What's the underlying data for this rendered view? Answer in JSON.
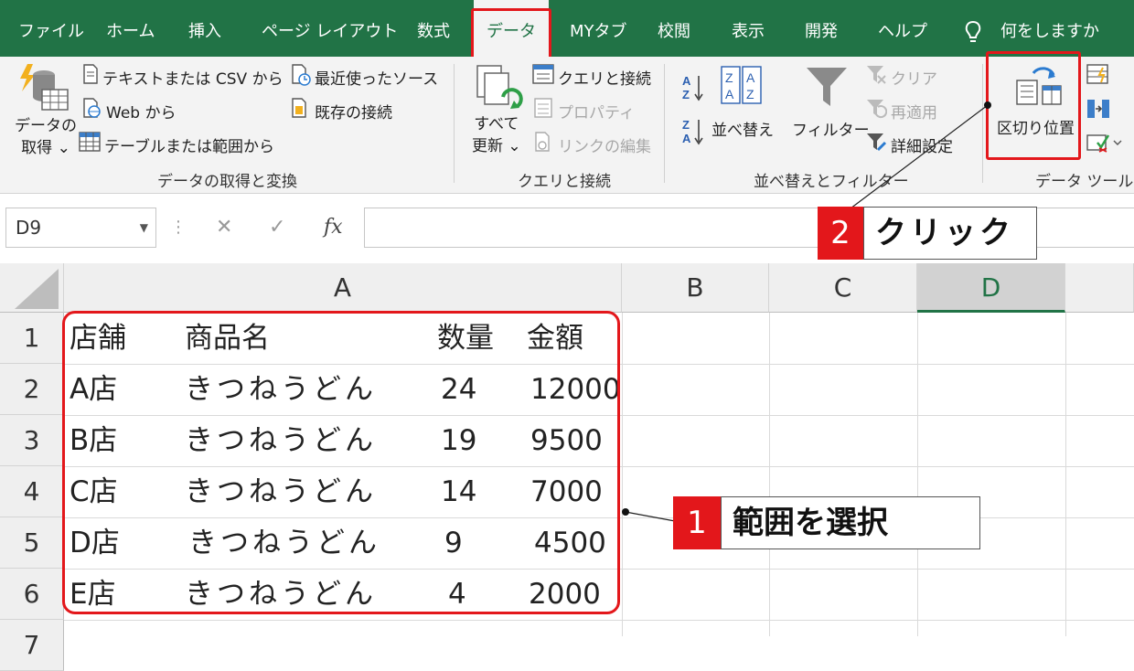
{
  "ribbon_tabs": [
    {
      "label": "ファイル"
    },
    {
      "label": "ホーム"
    },
    {
      "label": "挿入"
    },
    {
      "label": "ページ レイアウト"
    },
    {
      "label": "数式"
    },
    {
      "label": "データ",
      "active": true
    },
    {
      "label": "MYタブ"
    },
    {
      "label": "校閲"
    },
    {
      "label": "表示"
    },
    {
      "label": "開発"
    },
    {
      "label": "ヘルプ"
    }
  ],
  "tell_me": "何をしますか",
  "groups": {
    "get_data": {
      "label": "データの取得と変換",
      "get_data_button": [
        "データの",
        "取得 ⌄"
      ],
      "text_csv": "テキストまたは CSV から",
      "web": "Web から",
      "table_range": "テーブルまたは範囲から",
      "recent_sources": "最近使ったソース",
      "existing_connections": "既存の接続"
    },
    "queries": {
      "label": "クエリと接続",
      "refresh_all": [
        "すべて",
        "更新 ⌄"
      ],
      "queries_connections": "クエリと接続",
      "properties": "プロパティ",
      "edit_links": "リンクの編集"
    },
    "sort_filter": {
      "label": "並べ替えとフィルター",
      "sort": "並べ替え",
      "filter": "フィルター",
      "clear": "クリア",
      "reapply": "再適用",
      "advanced": "詳細設定"
    },
    "data_tools": {
      "label": "データ ツール",
      "text_to_columns": "区切り位置"
    }
  },
  "formula_bar": {
    "name_box": "D9",
    "cancel": "✕",
    "enter": "✓",
    "fx": "fx",
    "value": ""
  },
  "columns": [
    "A",
    "B",
    "C",
    "D"
  ],
  "rows": [
    "1",
    "2",
    "3",
    "4",
    "5",
    "6",
    "7"
  ],
  "sheet": [
    [
      "店舗",
      "商品名",
      "数量",
      "金額"
    ],
    [
      "A店",
      "きつねうどん",
      "24",
      "12000"
    ],
    [
      "B店",
      "きつねうどん",
      "19",
      "9500"
    ],
    [
      "C店",
      "きつねうどん",
      "14",
      "7000"
    ],
    [
      "D店",
      "きつねうどん",
      "9",
      "4500"
    ],
    [
      "E店",
      "きつねうどん",
      "4",
      "2000"
    ]
  ],
  "callouts": [
    {
      "num": "1",
      "text": "範囲を選択"
    },
    {
      "num": "2",
      "text": "クリック"
    }
  ],
  "colors": {
    "excel_green": "#217346",
    "highlight_red": "#e3171b"
  }
}
